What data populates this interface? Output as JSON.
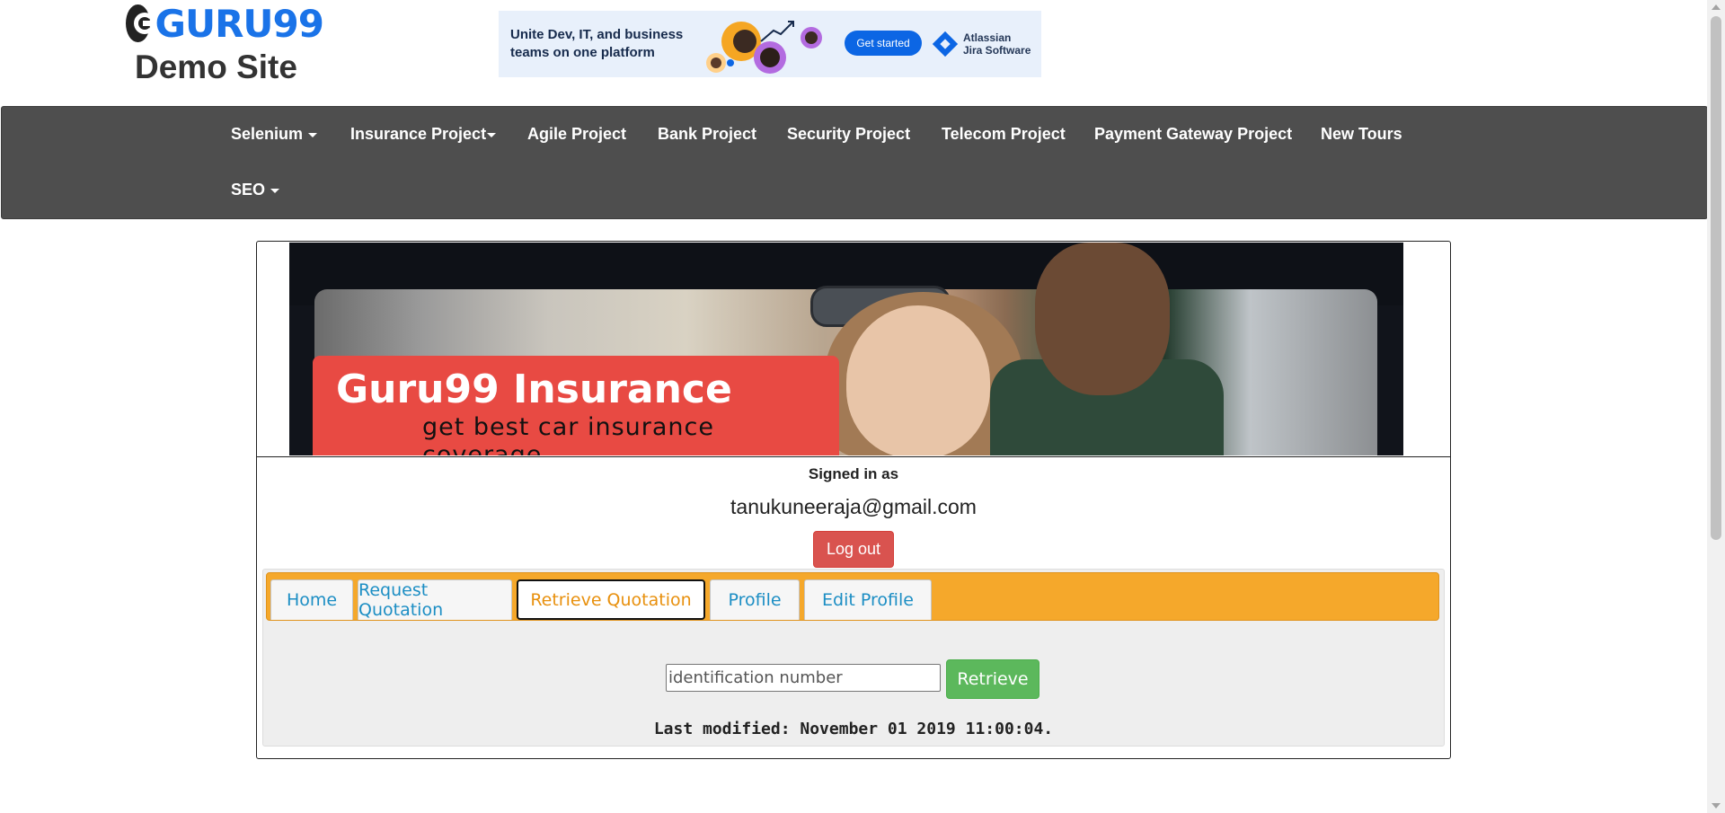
{
  "header": {
    "logo_text": "GURU99",
    "site_title": "Demo Site"
  },
  "ad": {
    "headline": "Unite Dev, IT, and business teams on one platform",
    "cta": "Get started",
    "brand_line1": "Atlassian",
    "brand_line2": "Jira Software",
    "accent": "#0c66e4"
  },
  "nav": {
    "items": [
      {
        "label": "Selenium",
        "dropdown": true
      },
      {
        "label": "Insurance Project",
        "dropdown": true
      },
      {
        "label": "Agile Project",
        "dropdown": false
      },
      {
        "label": "Bank Project",
        "dropdown": false
      },
      {
        "label": "Security Project",
        "dropdown": false
      },
      {
        "label": "Telecom Project",
        "dropdown": false
      },
      {
        "label": "Payment Gateway Project",
        "dropdown": false
      },
      {
        "label": "New Tours",
        "dropdown": false
      },
      {
        "label": "SEO",
        "dropdown": true
      }
    ]
  },
  "banner": {
    "title": "Guru99 Insurance",
    "subtitle": "get best car insurance coverage",
    "label_color": "#e84a43"
  },
  "account": {
    "signed_in_label": "Signed in as",
    "email": "tanukuneeraja@gmail.com",
    "logout_label": "Log out"
  },
  "tabs": {
    "items": [
      {
        "label": "Home"
      },
      {
        "label": "Request Quotation"
      },
      {
        "label": "Retrieve Quotation"
      },
      {
        "label": "Profile"
      },
      {
        "label": "Edit Profile"
      }
    ],
    "active": "Retrieve Quotation",
    "bar_color": "#f5a82b"
  },
  "retrieve": {
    "placeholder": "identification number",
    "value": "",
    "button_label": "Retrieve",
    "button_color": "#5cb85c"
  },
  "footer": {
    "last_modified": "Last modified: November 01 2019 11:00:04."
  }
}
